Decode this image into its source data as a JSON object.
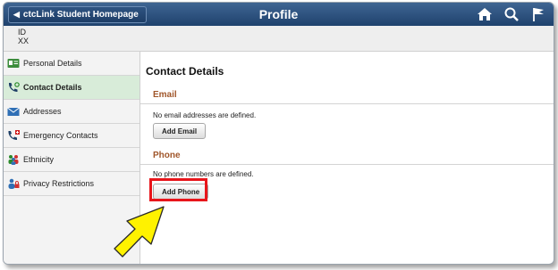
{
  "header": {
    "back_label": "ctcLink Student Homepage",
    "title": "Profile",
    "icons": [
      "home-icon",
      "search-icon",
      "flag-icon"
    ]
  },
  "id_bar": {
    "label": "ID",
    "value": "XX"
  },
  "sidebar": {
    "items": [
      {
        "label": "Personal Details",
        "icon": "id-card-icon",
        "active": false
      },
      {
        "label": "Contact Details",
        "icon": "phone-contact-icon",
        "active": true
      },
      {
        "label": "Addresses",
        "icon": "envelope-icon",
        "active": false
      },
      {
        "label": "Emergency Contacts",
        "icon": "emergency-phone-icon",
        "active": false
      },
      {
        "label": "Ethnicity",
        "icon": "people-icon",
        "active": false
      },
      {
        "label": "Privacy Restrictions",
        "icon": "person-lock-icon",
        "active": false
      }
    ]
  },
  "main": {
    "title": "Contact Details",
    "email": {
      "title": "Email",
      "message": "No email addresses are defined.",
      "button": "Add Email"
    },
    "phone": {
      "title": "Phone",
      "message": "No phone numbers are defined.",
      "button": "Add Phone"
    }
  },
  "annotations": {
    "highlight_color": "#e8151b",
    "arrow_color": "#fff200"
  }
}
